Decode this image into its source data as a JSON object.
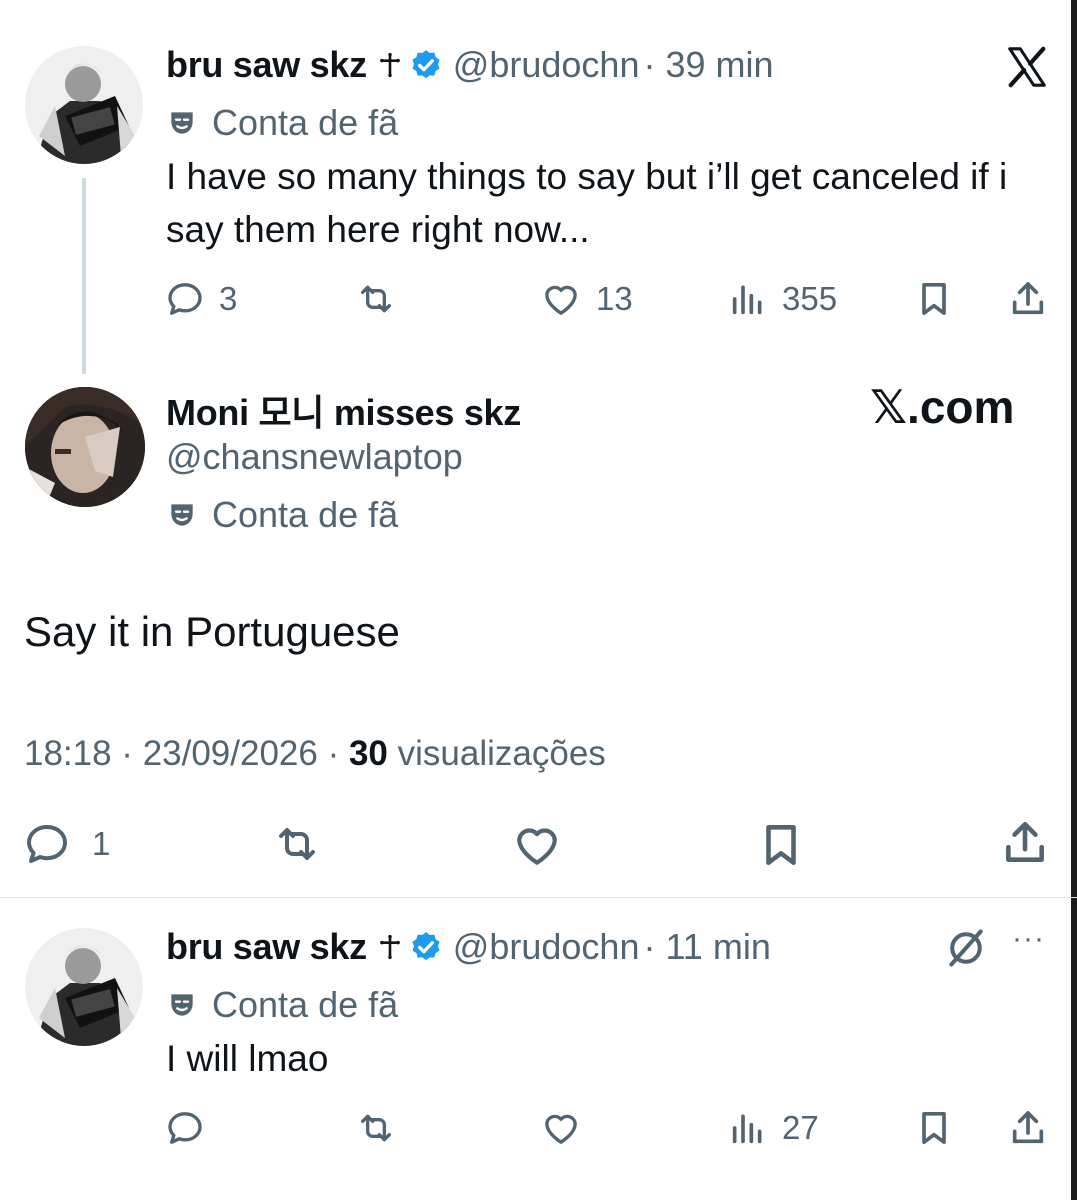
{
  "tweet1": {
    "name": "bru saw skz",
    "handle": "@brudochn",
    "time": "· 39 min",
    "fan_label": "Conta de fã",
    "text": "I have so many things to say but i’ll get canceled if i say them here right now...",
    "replies": "3",
    "likes": "13",
    "views": "355"
  },
  "tweet2": {
    "name": "Moni 모니 misses skz",
    "handle": "@chansnewlaptop",
    "fan_label": "Conta de fã",
    "text": "Say it in Portuguese",
    "timestamp": "18:18 · 23/09/2026 · ",
    "view_count": "30",
    "view_label": " visualizações",
    "replies": "1",
    "watermark": "𝕏.com"
  },
  "tweet3": {
    "name": "bru saw skz",
    "handle": "@brudochn",
    "time": "· 11 min",
    "fan_label": "Conta de fã",
    "text": "I will lmao",
    "views": "27"
  },
  "icons": {
    "x_logo": "x-logo-icon",
    "verified": "verified-badge-icon",
    "cross": "cross-emoji-icon",
    "mask": "theater-mask-icon",
    "reply": "reply-icon",
    "retweet": "retweet-icon",
    "like": "heart-icon",
    "views": "views-icon",
    "bookmark": "bookmark-icon",
    "share": "share-icon",
    "grok": "grok-icon",
    "more": "more-icon"
  },
  "colors": {
    "text": "#0f1419",
    "secondary": "#536471",
    "verified": "#1d9bf0"
  }
}
